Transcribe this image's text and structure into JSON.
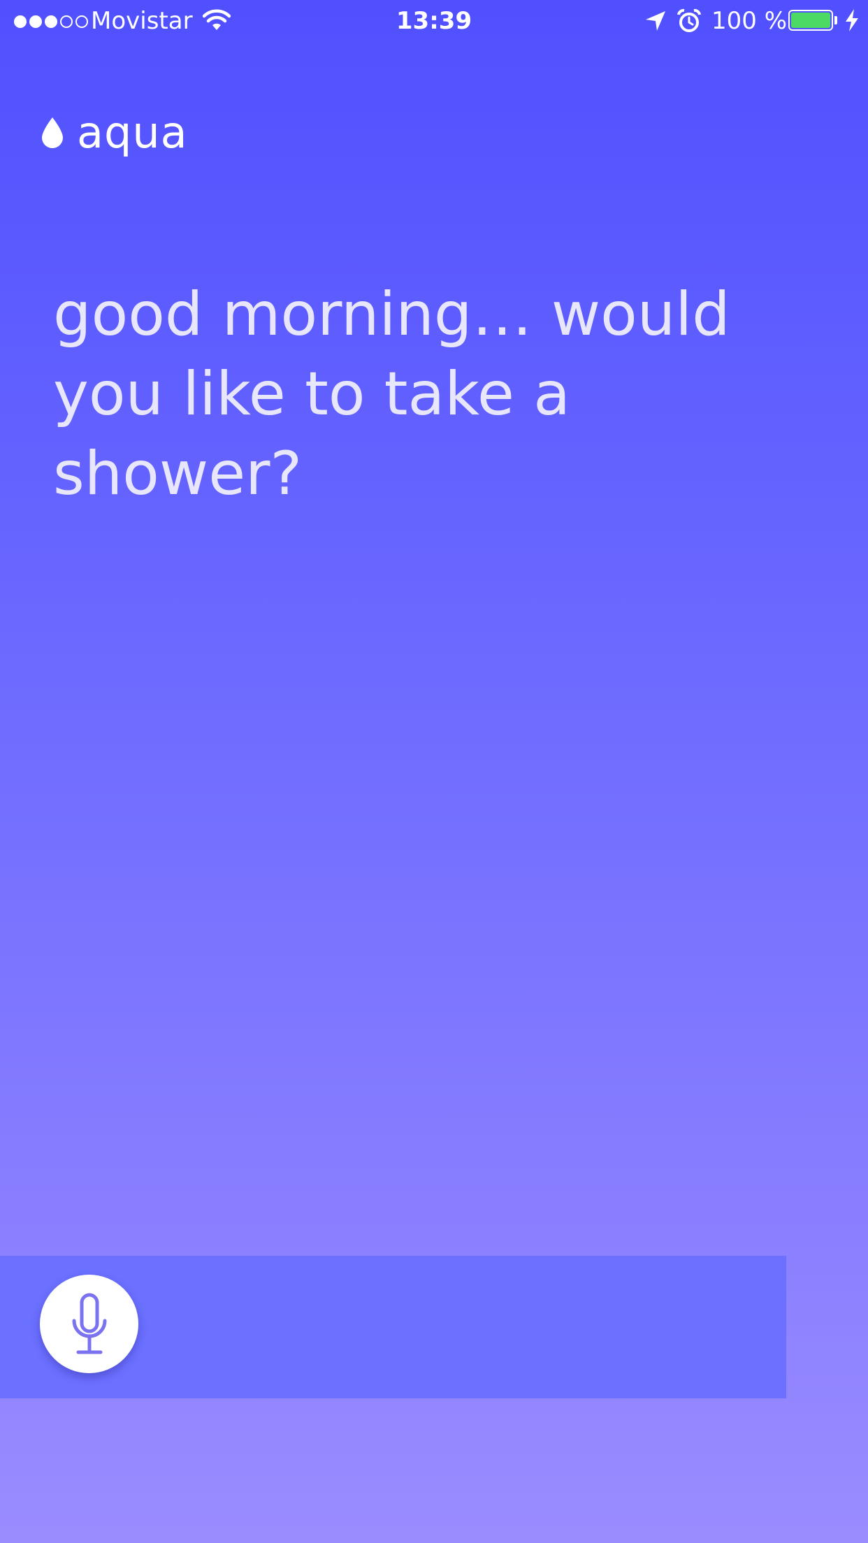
{
  "status_bar": {
    "carrier": "Movistar",
    "signal_bars_filled": 3,
    "signal_bars_total": 5,
    "time": "13:39",
    "battery_percent": "100 %",
    "battery_level": 1.0,
    "icons": [
      "wifi-icon",
      "location-arrow-icon",
      "alarm-clock-icon",
      "battery-icon",
      "charging-bolt-icon"
    ]
  },
  "header": {
    "logo_text": "aqua",
    "logo_icon": "water-drop-icon"
  },
  "main": {
    "greeting": "good morning… would you like to take a shower?"
  },
  "voice_bar": {
    "mic_icon": "microphone-icon"
  },
  "colors": {
    "gradient_top": "#5050ff",
    "gradient_bottom": "#9a8cff",
    "voice_bar": "#6b70ff",
    "mic_accent": "#7b72f0",
    "battery_green": "#4cd964",
    "greeting_text": "#e8e6fb"
  }
}
